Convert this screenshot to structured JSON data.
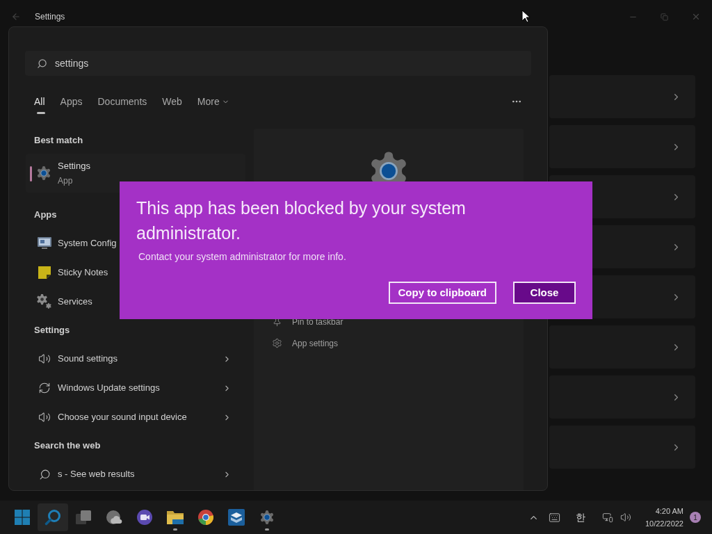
{
  "window": {
    "title": "Settings"
  },
  "search": {
    "value": "settings"
  },
  "tabs": [
    {
      "label": "All",
      "selected": true,
      "dropdown": false
    },
    {
      "label": "Apps",
      "selected": false,
      "dropdown": false
    },
    {
      "label": "Documents",
      "selected": false,
      "dropdown": false
    },
    {
      "label": "Web",
      "selected": false,
      "dropdown": false
    },
    {
      "label": "More",
      "selected": false,
      "dropdown": true
    }
  ],
  "best_match": {
    "heading": "Best match",
    "name": "Settings",
    "type": "App",
    "selected": true
  },
  "apps": {
    "heading": "Apps",
    "items": [
      {
        "name": "System Config",
        "kind": "monitor"
      },
      {
        "name": "Sticky Notes",
        "kind": "note"
      },
      {
        "name": "Services",
        "kind": "gears"
      }
    ]
  },
  "settings_results": {
    "heading": "Settings",
    "items": [
      {
        "name": "Sound settings",
        "kind": "speaker"
      },
      {
        "name": "Windows Update settings",
        "kind": "update"
      },
      {
        "name": "Choose your sound input device",
        "kind": "speaker"
      }
    ]
  },
  "web": {
    "heading": "Search the web",
    "items": [
      {
        "name": "s - See web results",
        "kind": "search"
      }
    ]
  },
  "preview": {
    "actions": [
      {
        "label": "Pin to taskbar",
        "kind": "pin"
      },
      {
        "label": "App settings",
        "kind": "gear"
      }
    ]
  },
  "dialog": {
    "title": "This app has been blocked by your system administrator.",
    "message": "Contact your system administrator for more info.",
    "buttons": [
      {
        "label": "Copy to clipboard",
        "primary": false
      },
      {
        "label": "Close",
        "primary": true
      }
    ]
  },
  "taskbar": {
    "apps": [
      {
        "kind": "start",
        "selected": false,
        "running": false
      },
      {
        "kind": "search",
        "selected": true,
        "running": false
      },
      {
        "kind": "taskview",
        "selected": false,
        "running": false
      },
      {
        "kind": "widgets",
        "selected": false,
        "running": false
      },
      {
        "kind": "chat",
        "selected": false,
        "running": false
      },
      {
        "kind": "folder",
        "selected": false,
        "running": true
      },
      {
        "kind": "browser",
        "selected": false,
        "running": false
      },
      {
        "kind": "box",
        "selected": false,
        "running": false
      },
      {
        "kind": "settings",
        "selected": false,
        "running": true
      }
    ],
    "tray": {
      "ime": "한",
      "time": "4:20 AM",
      "date": "10/22/2022",
      "notifications": "1"
    }
  }
}
